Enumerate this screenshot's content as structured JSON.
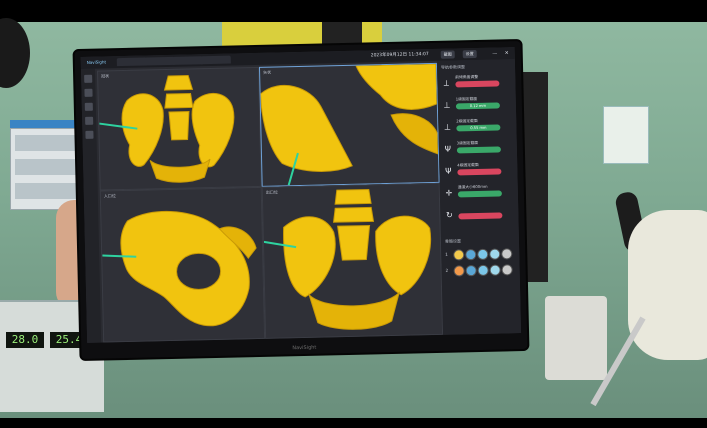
{
  "app": {
    "brand": "NaviSight",
    "tabs": [
      "",
      "",
      "",
      ""
    ],
    "datetime": "2023年09月12日 11:34:07",
    "toolbar_buttons": [
      "截图",
      "设置"
    ],
    "window_controls": [
      "—",
      "✕"
    ]
  },
  "viewports": [
    {
      "id": "vp1",
      "label": "冠状",
      "active": false
    },
    {
      "id": "vp2",
      "label": "矢状",
      "active": true
    },
    {
      "id": "vp3",
      "label": "入口位",
      "active": false
    },
    {
      "id": "vp4",
      "label": "出口位",
      "active": false
    }
  ],
  "panel": {
    "title": "导航参数调整",
    "params": [
      {
        "label": "前倾角度调整",
        "value": "",
        "color": "#d9465f",
        "icon": "angle-icon"
      },
      {
        "label": "1级固定截面",
        "value": "0.12 mm",
        "color": "#3aa869",
        "icon": "plane-icon"
      },
      {
        "label": "2级固定截面",
        "value": "0.55 mm",
        "color": "#3aa869",
        "icon": "plane-icon"
      },
      {
        "label": "3级固定截面",
        "value": "",
        "color": "#3aa869",
        "icon": "axis-icon"
      },
      {
        "label": "4级固定截面",
        "value": "",
        "color": "#d9465f",
        "icon": "axis-icon"
      },
      {
        "label": "通道大小600mm",
        "value": "",
        "color": "#3aa869",
        "icon": "cross-icon"
      },
      {
        "label": "",
        "value": "",
        "color": "#d9465f",
        "icon": "rotate-icon"
      }
    ],
    "material_title": "骨骼设置",
    "material_rows": [
      {
        "label": "1",
        "swatches": [
          "#f2c94c",
          "#5aa7d6",
          "#7bc6e8",
          "#9fd8ec",
          "#c9c9c9"
        ]
      },
      {
        "label": "2",
        "swatches": [
          "#f2994a",
          "#5aa7d6",
          "#7bc6e8",
          "#9fd8ec",
          "#c9c9c9"
        ]
      }
    ]
  },
  "monitor_brand": "NaviSight",
  "equipment": {
    "display_left": "28.0",
    "display_right": "25.4"
  },
  "colors": {
    "bone": "#f1c40f",
    "bone_shadow": "#c99a06",
    "guide_line": "#2ed3a0"
  }
}
